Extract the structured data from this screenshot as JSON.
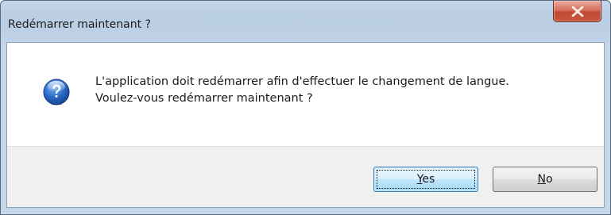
{
  "dialog": {
    "title": "Redémarrer maintenant ?",
    "close_label": "x",
    "message_line_1": "L'application doit redémarrer afin d'effectuer le changement de langue.",
    "message_line_2": "Voulez-vous redémarrer maintenant ?",
    "icon": "question-icon"
  },
  "buttons": {
    "yes": {
      "mnemonic": "Y",
      "rest": "es"
    },
    "no": {
      "mnemonic": "N",
      "rest": "o"
    }
  },
  "colors": {
    "title_bar": "#bed1e6",
    "close_button": "#c9543c",
    "icon_blue": "#1f5fb8",
    "button_area": "#f0f0f0",
    "default_button_border": "#3c7fb1"
  }
}
